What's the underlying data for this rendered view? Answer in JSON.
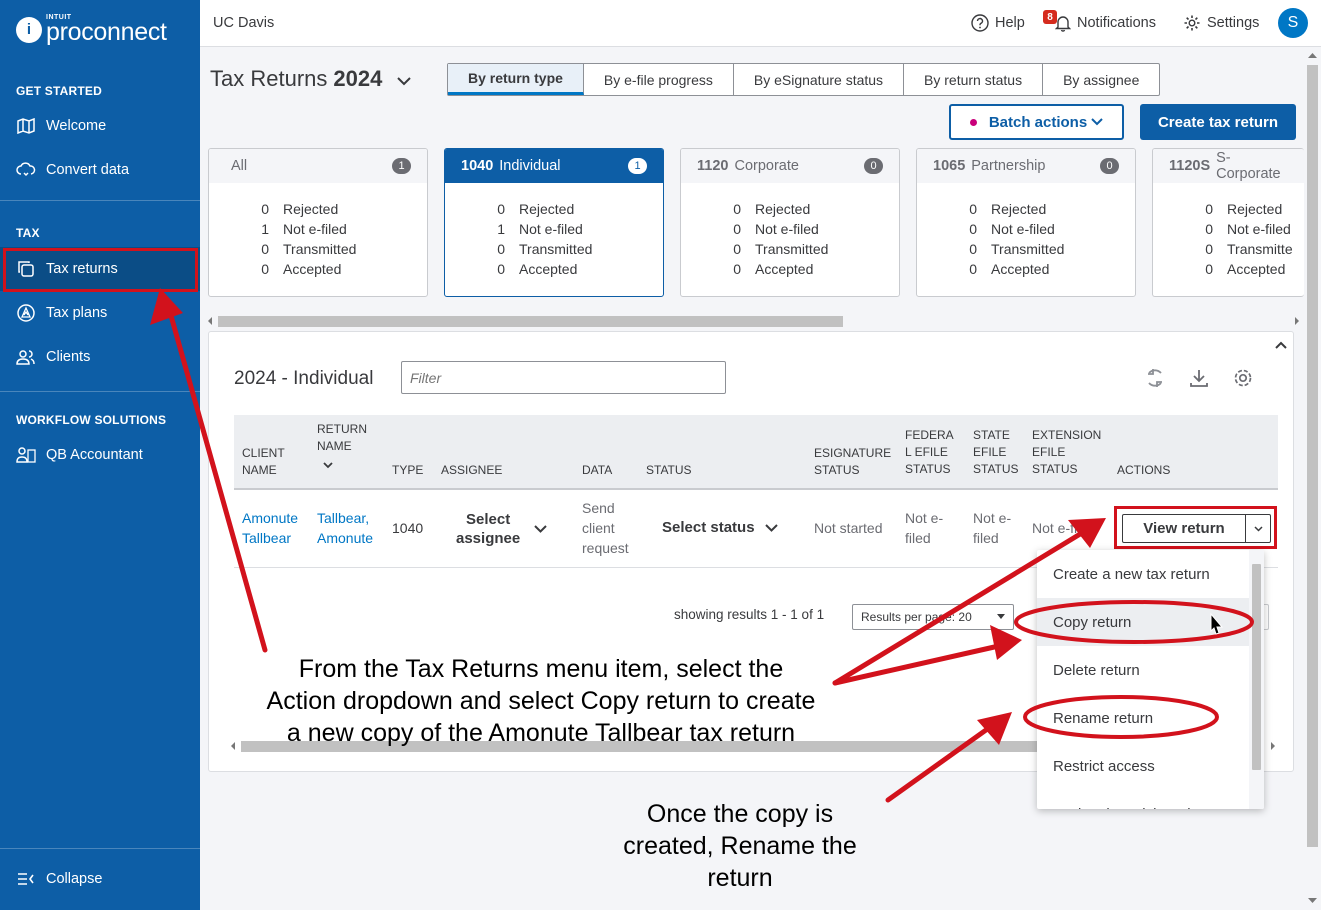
{
  "brand": {
    "intuit": "INTUIT",
    "product": "proconnect"
  },
  "sidebar": {
    "sections": {
      "get_started": "GET STARTED",
      "tax": "TAX",
      "workflow": "WORKFLOW SOLUTIONS"
    },
    "items": [
      {
        "label": "Welcome",
        "icon": "map-icon"
      },
      {
        "label": "Convert data",
        "icon": "cloud-sync-icon"
      },
      {
        "label": "Tax returns",
        "icon": "copy-icon",
        "active": true
      },
      {
        "label": "Tax plans",
        "icon": "triangle-circle-icon"
      },
      {
        "label": "Clients",
        "icon": "people-icon"
      },
      {
        "label": "QB Accountant",
        "icon": "qb-people-icon"
      }
    ],
    "collapse": "Collapse"
  },
  "topbar": {
    "org": "UC Davis",
    "help": "Help",
    "notifications": "Notifications",
    "notification_count": "8",
    "settings": "Settings",
    "avatar_initial": "S"
  },
  "heading": {
    "title": "Tax Returns",
    "year": "2024"
  },
  "tabs": [
    "By return type",
    "By e-file progress",
    "By eSignature status",
    "By return status",
    "By assignee"
  ],
  "actions": {
    "batch": "Batch actions",
    "create": "Create tax return"
  },
  "cards": [
    {
      "code": "",
      "name": "All",
      "count": "1",
      "rows": [
        [
          "0",
          "Rejected"
        ],
        [
          "1",
          "Not e-filed"
        ],
        [
          "0",
          "Transmitted"
        ],
        [
          "0",
          "Accepted"
        ]
      ]
    },
    {
      "code": "1040",
      "name": "Individual",
      "count": "1",
      "selected": true,
      "rows": [
        [
          "0",
          "Rejected"
        ],
        [
          "1",
          "Not e-filed"
        ],
        [
          "0",
          "Transmitted"
        ],
        [
          "0",
          "Accepted"
        ]
      ]
    },
    {
      "code": "1120",
      "name": "Corporate",
      "count": "0",
      "rows": [
        [
          "0",
          "Rejected"
        ],
        [
          "0",
          "Not e-filed"
        ],
        [
          "0",
          "Transmitted"
        ],
        [
          "0",
          "Accepted"
        ]
      ]
    },
    {
      "code": "1065",
      "name": "Partnership",
      "count": "0",
      "rows": [
        [
          "0",
          "Rejected"
        ],
        [
          "0",
          "Not e-filed"
        ],
        [
          "0",
          "Transmitted"
        ],
        [
          "0",
          "Accepted"
        ]
      ]
    },
    {
      "code": "1120S",
      "name": "S-Corporate",
      "count": "",
      "rows": [
        [
          "0",
          "Rejected"
        ],
        [
          "0",
          "Not e-filed"
        ],
        [
          "0",
          "Transmitte"
        ],
        [
          "0",
          "Accepted"
        ]
      ]
    }
  ],
  "panel": {
    "title": "2024 - Individual",
    "filter_placeholder": "Filter",
    "columns": {
      "client": [
        "CLIENT",
        "NAME"
      ],
      "return": [
        "RETURN",
        "NAME"
      ],
      "type": "TYPE",
      "assignee": "ASSIGNEE",
      "data": "DATA",
      "status": "STATUS",
      "esig": [
        "ESIGNATURE",
        "STATUS"
      ],
      "federal": [
        "FEDERA",
        "L EFILE",
        "STATUS"
      ],
      "state": [
        "STATE",
        "EFILE",
        "STATUS"
      ],
      "extension": [
        "EXTENSION",
        "EFILE",
        "STATUS"
      ],
      "actions": "ACTIONS"
    },
    "row": {
      "client": [
        "Amonute",
        "Tallbear"
      ],
      "return": [
        "Tallbear,",
        "Amonute"
      ],
      "type": "1040",
      "assignee": [
        "Select",
        "assignee"
      ],
      "data": [
        "Send",
        "client",
        "request"
      ],
      "status": "Select status",
      "esig": "Not started",
      "federal": [
        "Not e-",
        "filed"
      ],
      "state": [
        "Not e-",
        "filed"
      ],
      "extension": "Not e-filed",
      "view": "View return"
    },
    "results": "showing results 1 - 1 of 1",
    "per_page": "Results per page: 20"
  },
  "menu": [
    "Create a new tax return",
    "Copy return",
    "Delete return",
    "Rename return",
    "Restrict access",
    "Lookup in QuickBooks"
  ],
  "annotations": {
    "main": [
      "From the Tax Returns menu item, select the",
      "Action dropdown and select Copy return to create",
      "a new copy of the Amonute Tallbear tax return"
    ],
    "second": [
      "Once the copy is",
      "created, Rename the",
      "return"
    ]
  },
  "colors": {
    "sidebar": "#0d5ea6",
    "primary": "#0d5ea6",
    "link": "#0077c5",
    "annotation": "#d2121c",
    "badge": "#d52b1e"
  }
}
